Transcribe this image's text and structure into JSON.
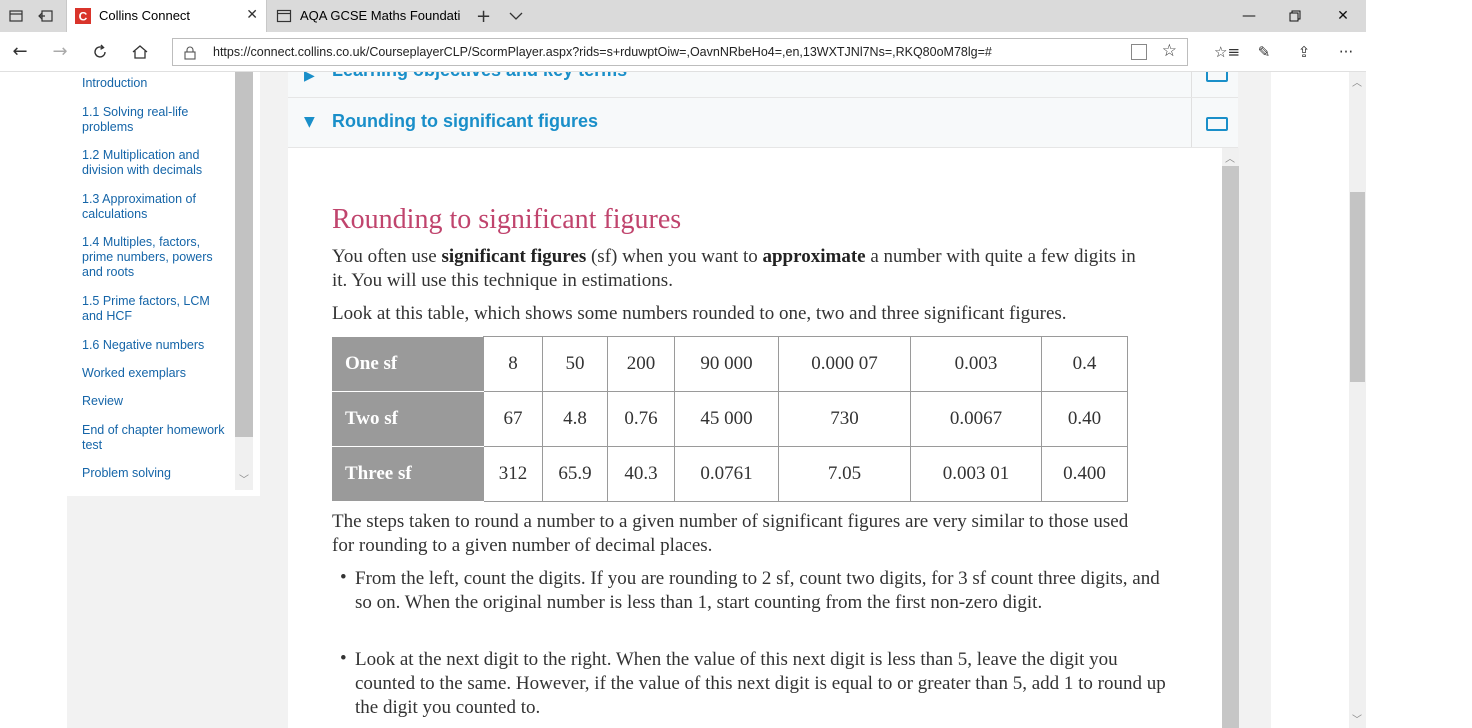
{
  "browser": {
    "tabs": [
      {
        "title": "Collins Connect",
        "active": true,
        "favicon_letter": "C"
      },
      {
        "title": "AQA GCSE Maths Foundatic",
        "active": false
      }
    ],
    "url": "https://connect.collins.co.uk/CourseplayerCLP/ScormPlayer.aspx?rids=s+rduwptOiw=,OavnNRbeHo4=,en,13WXTJNl7Ns=,RKQ80oM78lg=#",
    "accent_color": "#d9342b"
  },
  "sidebar": {
    "items": [
      {
        "label": "Introduction"
      },
      {
        "label": "1.1 Solving real-life problems"
      },
      {
        "label": "1.2 Multiplication and division with decimals"
      },
      {
        "label": "1.3 Approximation of calculations"
      },
      {
        "label": "1.4 Multiples, factors, prime numbers, powers and roots"
      },
      {
        "label": "1.5 Prime factors, LCM and HCF"
      },
      {
        "label": "1.6 Negative numbers"
      },
      {
        "label": "Worked exemplars"
      },
      {
        "label": "Review"
      },
      {
        "label": "End of chapter homework test"
      },
      {
        "label": "Problem solving"
      }
    ]
  },
  "accordion": {
    "prev_title": "Learning objectives and key terms",
    "current_title": "Rounding to significant figures"
  },
  "lesson": {
    "heading": "Rounding to significant figures",
    "intro_1": "You often use ",
    "intro_bold_1": "significant figures",
    "intro_2": " (sf) when you want to ",
    "intro_bold_2": "approximate",
    "intro_3": " a number with quite a few digits in it. You will use this technique in estimations.",
    "table_intro": "Look at this table, which shows some numbers rounded to one, two and three significant figures.",
    "table": {
      "rows": [
        {
          "label": "One sf",
          "values": [
            "8",
            "50",
            "200",
            "90 000",
            "0.000 07",
            "0.003",
            "0.4"
          ]
        },
        {
          "label": "Two sf",
          "values": [
            "67",
            "4.8",
            "0.76",
            "45 000",
            "730",
            "0.0067",
            "0.40"
          ]
        },
        {
          "label": "Three sf",
          "values": [
            "312",
            "65.9",
            "40.3",
            "0.0761",
            "7.05",
            "0.003 01",
            "0.400"
          ]
        }
      ]
    },
    "steps_intro": "The steps taken to round a number to a given number of significant figures are very similar to those used for rounding to a given number of decimal places.",
    "bullets": [
      "From the left, count the digits. If you are rounding to 2 sf, count two digits, for 3 sf count three digits, and so on. When the original number is less than 1, start counting from the first non-zero digit.",
      "Look at the next digit to the right. When the value of this next digit is less than 5, leave the digit you counted to the same. However, if the value of this next digit is equal to or greater than 5, add 1 to round up the digit you counted to."
    ],
    "heading_color": "#c0446d",
    "link_color": "#1a8fc9"
  }
}
